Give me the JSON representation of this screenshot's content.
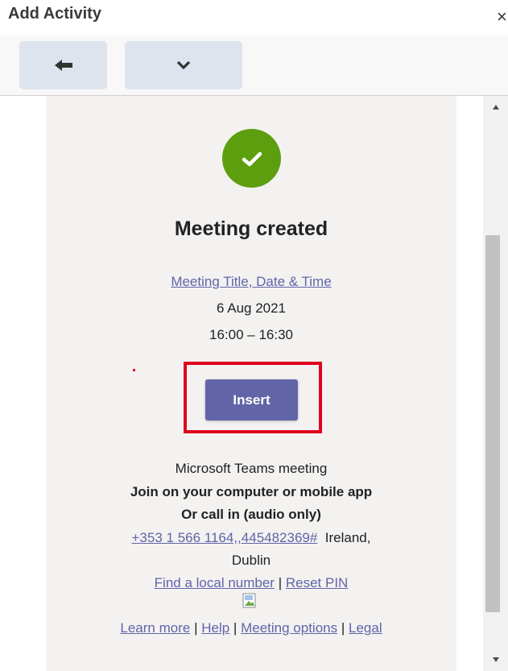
{
  "header": {
    "title": "Add Activity",
    "close_symbol": "×"
  },
  "toolbar": {
    "back_icon": "back-arrow-icon",
    "more_icon": "chevron-down-icon"
  },
  "meeting": {
    "heading": "Meeting created",
    "title_link": "Meeting Title, Date & Time",
    "date": "6 Aug 2021",
    "time": "16:00 – 16:30",
    "insert_label": "Insert",
    "teams_label": "Microsoft Teams meeting",
    "join_text": "Join on your computer or mobile app",
    "call_text": "Or call in (audio only)",
    "phone": "+353 1 566 1164,,445482369#",
    "location_line1": "Ireland,",
    "location_line2": "Dublin",
    "find_local": "Find a local number",
    "separator": "|",
    "reset_pin": "Reset PIN",
    "learn_more": "Learn more",
    "help": "Help",
    "meeting_options": "Meeting options",
    "legal": "Legal"
  },
  "colors": {
    "accent": "#6264a7",
    "success": "#5d9e0f",
    "highlight": "#e0001b",
    "toolbar_button": "#dde4ee"
  }
}
